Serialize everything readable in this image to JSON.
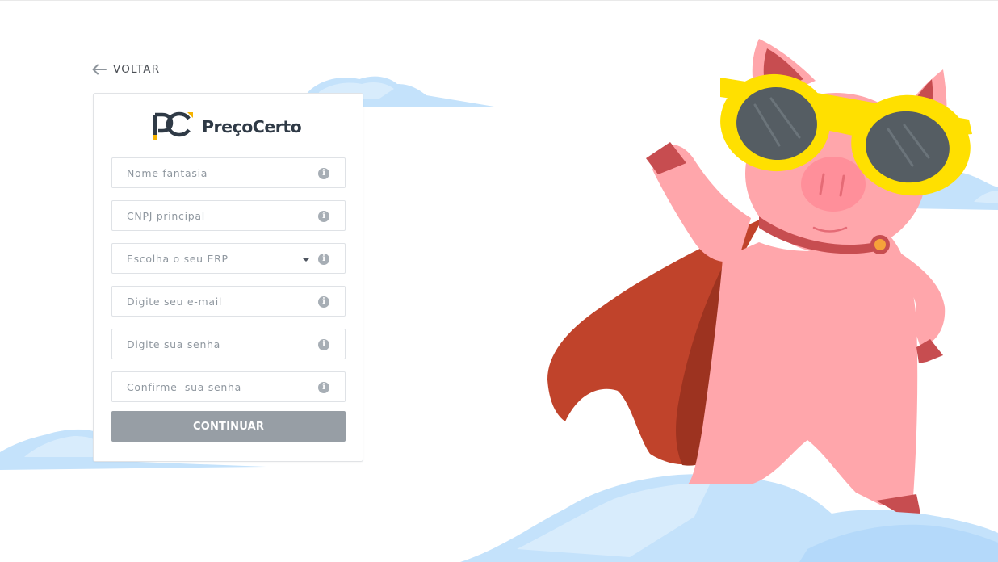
{
  "nav": {
    "back_label": "VOLTAR"
  },
  "brand": {
    "name": "PreçoCerto",
    "mark": "PC"
  },
  "form": {
    "fields": [
      {
        "placeholder": "Nome fantasia"
      },
      {
        "placeholder": "CNPJ principal"
      },
      {
        "placeholder": "Escolha o seu ERP"
      },
      {
        "placeholder": "Digite seu e-mail"
      },
      {
        "placeholder": "Digite sua senha"
      },
      {
        "placeholder": "Confirme  sua senha"
      }
    ],
    "submit_label": "CONTINUAR"
  },
  "colors": {
    "button_disabled": "#979ea5",
    "cloud": "#c4e2fb",
    "pig": "#ffa6ab",
    "cape": "#c0432b",
    "glasses": "#ffe000",
    "brand_accent": "#f6b300",
    "text_dark": "#2f3a46"
  },
  "icons": [
    "arrow-left-icon",
    "info-icon",
    "chevron-down-icon",
    "precocerto-logo-icon",
    "pig-mascot-illustration"
  ]
}
